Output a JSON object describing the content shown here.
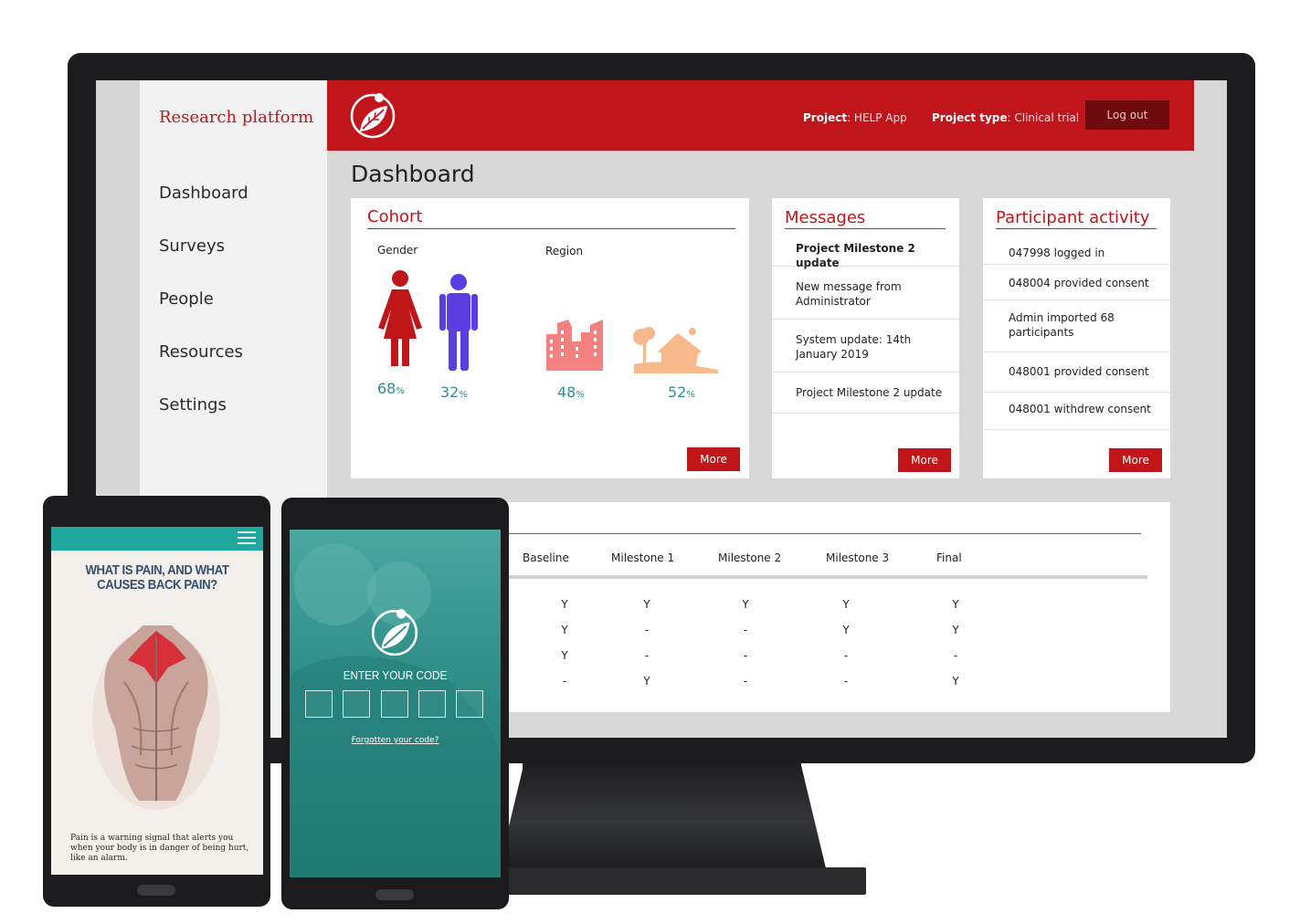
{
  "app": {
    "brand": "Research platform",
    "nav": [
      "Dashboard",
      "Surveys",
      "People",
      "Resources",
      "Settings"
    ],
    "project_label": "Project",
    "project_value": ": HELP App",
    "project_type_label": "Project type",
    "project_type_value": ": Clinical trial",
    "logout": "Log out",
    "page_title": "Dashboard",
    "accent": "#c0151b"
  },
  "cohort": {
    "title": "Cohort",
    "gender_label": "Gender",
    "region_label": "Region",
    "female_value": "68",
    "male_value": "32",
    "urban_value": "48",
    "rural_value": "52",
    "pct_sign": "%",
    "more": "More"
  },
  "messages": {
    "title": "Messages",
    "items": [
      "Project Milestone 2 update",
      "New message from Administrator",
      "System update: 14th January 2019",
      "Project Milestone 2 update"
    ],
    "more": "More"
  },
  "activity": {
    "title": "Participant activity",
    "items": [
      "047998 logged in",
      "048004 provided consent",
      "Admin imported 68 participants",
      "048001 provided consent",
      "048001 withdrew consent"
    ],
    "more": "More"
  },
  "milestones": {
    "headers": [
      "Baseline",
      "Milestone 1",
      "Milestone 2",
      "Milestone 3",
      "Final"
    ],
    "rows": [
      [
        "Y",
        "Y",
        "Y",
        "Y",
        "Y"
      ],
      [
        "Y",
        "-",
        "-",
        "Y",
        "Y"
      ],
      [
        "Y",
        "-",
        "-",
        "-",
        "-"
      ],
      [
        "-",
        "Y",
        "-",
        "-",
        "Y"
      ]
    ]
  },
  "phone_article": {
    "headline_line1": "WHAT IS PAIN, AND WHAT",
    "headline_line2": "CAUSES BACK PAIN?",
    "body": "Pain is a warning signal that alerts you when your body is in danger of being hurt, like an alarm."
  },
  "phone_code": {
    "enter_label": "ENTER YOUR CODE",
    "forgot": "Forgotten your code?"
  }
}
